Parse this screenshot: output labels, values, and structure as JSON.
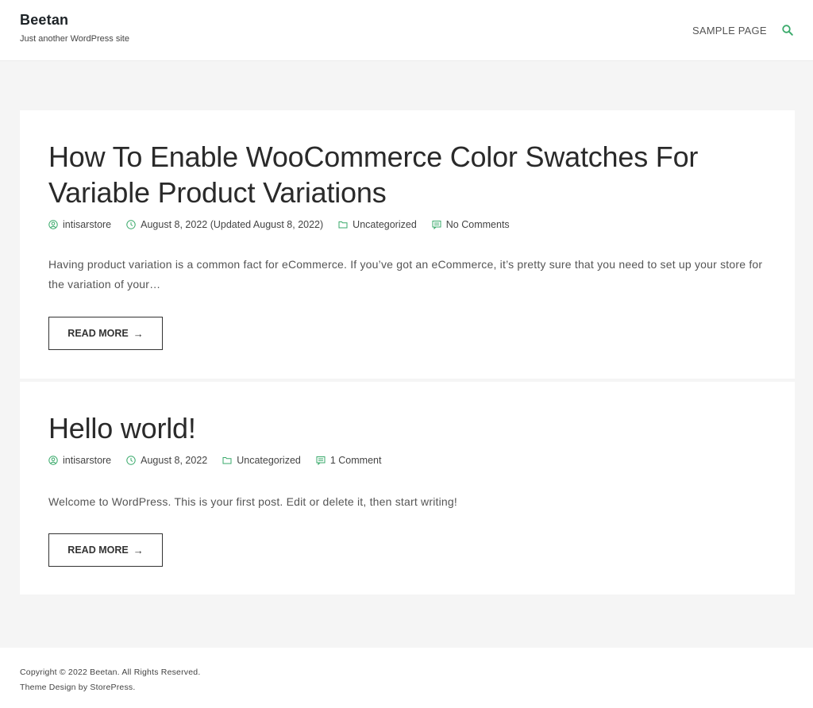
{
  "header": {
    "site_title": "Beetan",
    "tagline": "Just another WordPress site",
    "nav": [
      "SAMPLE PAGE"
    ],
    "search_icon": "search-icon"
  },
  "accent_color": "#3aaa6b",
  "posts": [
    {
      "title": "How To Enable WooCommerce Color Swatches For Variable Product Variations",
      "author": "intisarstore",
      "date": "August 8, 2022 (Updated August 8, 2022)",
      "category": "Uncategorized",
      "comments": "No Comments",
      "excerpt": "Having product variation is a common fact for eCommerce. If you’ve got an eCommerce, it’s pretty sure that you need to set up your store for the variation of your…",
      "read_more": "READ MORE"
    },
    {
      "title": "Hello world!",
      "author": "intisarstore",
      "date": "August 8, 2022",
      "category": "Uncategorized",
      "comments": "1 Comment",
      "excerpt": "Welcome to WordPress. This is your first post. Edit or delete it, then start writing!",
      "read_more": "READ MORE"
    }
  ],
  "read_more_arrow": "→",
  "footer": {
    "copyright": "Copyright © 2022 Beetan. All Rights Reserved.",
    "credit": "Theme Design by StorePress."
  }
}
